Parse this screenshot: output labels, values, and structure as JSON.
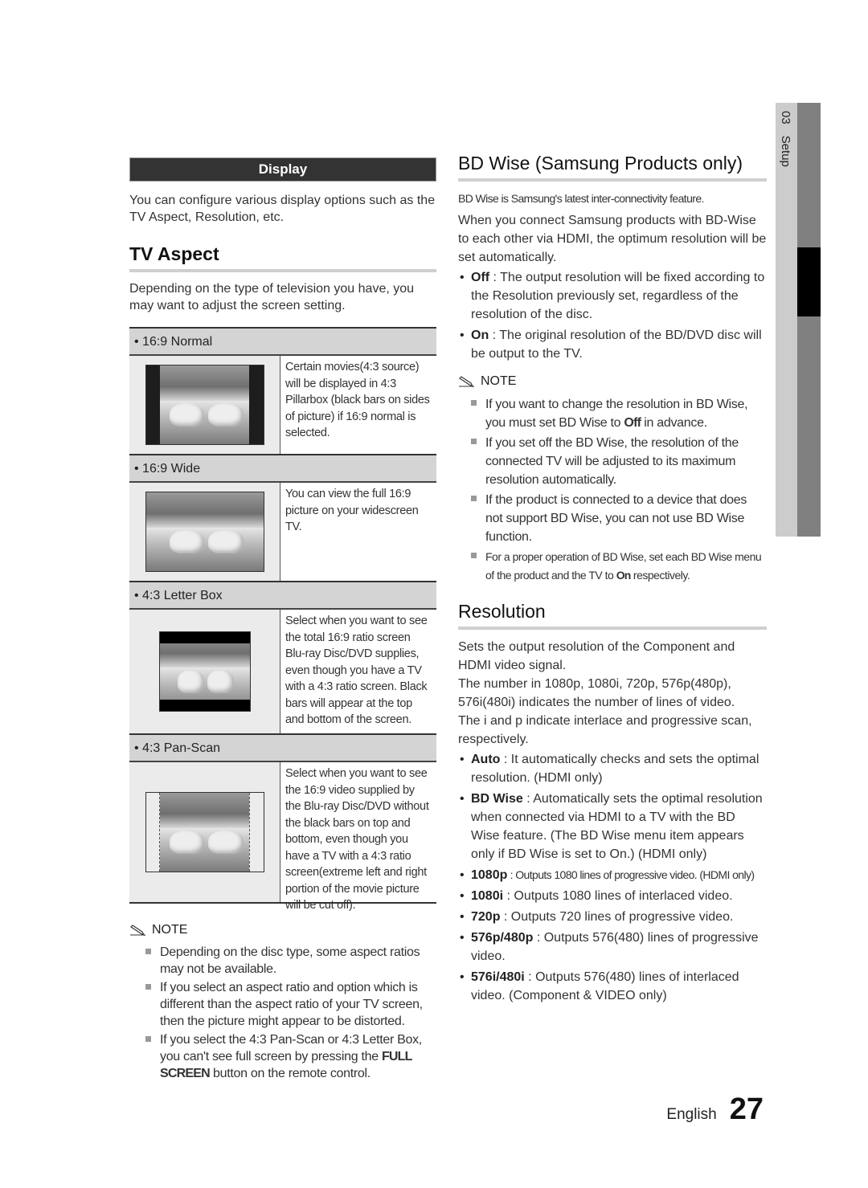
{
  "side_tab": {
    "chapter_number": "03",
    "chapter_title": "Setup"
  },
  "left": {
    "section_bar": "Display",
    "intro": "You can configure various display options such as the TV Aspect, Resolution, etc.",
    "tv_aspect": {
      "title": "TV Aspect",
      "description": "Depending on the type of television you have, you may want to adjust the screen setting.",
      "options": [
        {
          "label": "16:9 Normal",
          "picture": "pillarbox-picture",
          "description": "Certain movies(4:3 source) will be displayed in 4:3 Pillarbox (black bars on sides of picture) if 16:9 normal is selected."
        },
        {
          "label": "16:9 Wide",
          "picture": "widescreen-picture",
          "description": "You can view the full 16:9 picture on your widescreen TV."
        },
        {
          "label": "4:3 Letter Box",
          "picture": "letterbox-picture",
          "description": "Select when you want to see the total 16:9 ratio screen Blu-ray Disc/DVD supplies, even though you have a TV with a 4:3 ratio screen. Black bars will appear at the top and bottom of the screen."
        },
        {
          "label": "4:3 Pan-Scan",
          "picture": "panscan-picture",
          "description": "Select when you want to see the 16:9 video supplied by the Blu-ray Disc/DVD without the black bars on top and bottom, even though you have a TV with a 4:3 ratio screen(extreme left and right portion of the movie picture will be cut off)."
        }
      ]
    },
    "note": {
      "heading": "NOTE",
      "items": [
        "Depending on the disc type, some aspect ratios may not be available.",
        "If you select an aspect ratio and option which is different than the aspect ratio of your TV screen, then the picture might appear to be distorted."
      ],
      "item3_pre": "If you select the 4:3 Pan-Scan or 4:3 Letter Box, you can't see full screen by pressing the ",
      "item3_bold": "FULL SCREEN",
      "item3_post": " button on the remote control."
    }
  },
  "right": {
    "bd_wise": {
      "title": "BD Wise (Samsung Products only)",
      "subtitle": "BD Wise is Samsung's latest inter-connectivity feature.",
      "intro": "When you connect Samsung products with BD-Wise to each other via HDMI, the optimum resolution will be set automatically.",
      "options": [
        {
          "term": "Off",
          "text": " : The output resolution will be fixed according to the Resolution previously set, regardless of the resolution of the disc."
        },
        {
          "term": "On",
          "text": " : The original resolution of the BD/DVD disc will be output to the TV."
        }
      ],
      "note": {
        "heading": "NOTE",
        "item1_pre": "If you want to change the resolution in BD Wise, you must set BD Wise to ",
        "item1_bold": "Off",
        "item1_post": " in advance.",
        "item2": "If you set off the BD Wise, the resolution of the connected TV will be adjusted to its maximum resolution automatically.",
        "item3": "If the product is connected to a device that does not support BD Wise, you can not use BD Wise function.",
        "item4_pre": "For a proper operation of BD Wise, set each BD Wise menu of the product and the TV to ",
        "item4_bold": "On",
        "item4_post": " respectively."
      }
    },
    "resolution": {
      "title": "Resolution",
      "para1": "Sets the output resolution of the Component and HDMI video signal.",
      "para2": "The number in 1080p, 1080i, 720p, 576p(480p), 576i(480i) indicates the number of lines of video.",
      "para3": "The i and p indicate interlace and progressive scan, respectively.",
      "options": [
        {
          "term": "Auto",
          "text": " : It automatically checks and sets the optimal resolution. (HDMI only)"
        },
        {
          "term": "BD Wise",
          "text": " : Automatically sets the optimal resolution when connected via HDMI to a TV with the BD Wise feature. (The BD Wise menu item appears only if BD Wise is set to On.) (HDMI only)"
        },
        {
          "term": "1080p",
          "text": " : Outputs 1080 lines of progressive video. (HDMI only)"
        },
        {
          "term": "1080i",
          "text": " : Outputs 1080 lines of interlaced video."
        },
        {
          "term": "720p",
          "text": " : Outputs 720 lines of progressive video."
        },
        {
          "term": "576p/480p",
          "text": " : Outputs 576(480) lines of progressive video."
        },
        {
          "term": "576i/480i",
          "text": " : Outputs 576(480) lines of interlaced video. (Component & VIDEO only)"
        }
      ]
    }
  },
  "footer": {
    "language": "English",
    "page_number": "27"
  }
}
